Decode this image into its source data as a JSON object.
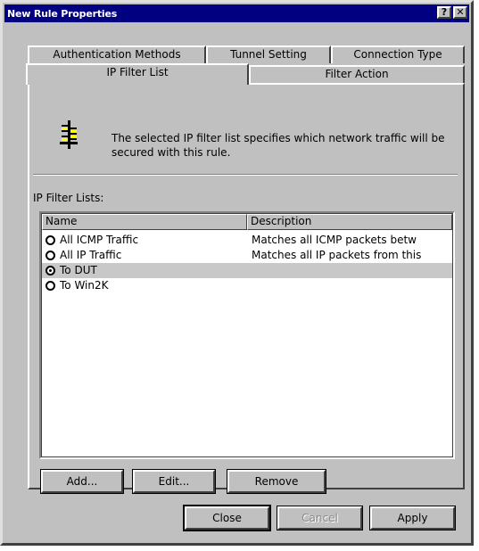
{
  "window": {
    "title": "New Rule Properties",
    "help_glyph": "?",
    "close_glyph": "✕"
  },
  "tabs": {
    "row1": [
      {
        "label": "Authentication Methods"
      },
      {
        "label": "Tunnel Setting"
      },
      {
        "label": "Connection Type"
      }
    ],
    "row2": [
      {
        "label": "IP Filter List",
        "active": true
      },
      {
        "label": "Filter Action"
      }
    ]
  },
  "panel": {
    "description": "The selected IP filter list specifies which network traffic will be secured with this rule.",
    "list_label": "IP Filter Lists:",
    "columns": [
      "Name",
      "Description"
    ],
    "rows": [
      {
        "name": "All ICMP Traffic",
        "description": "Matches all ICMP packets betw",
        "selected": false
      },
      {
        "name": "All IP Traffic",
        "description": "Matches all IP packets from this",
        "selected": false
      },
      {
        "name": "To DUT",
        "description": "",
        "selected": true
      },
      {
        "name": "To Win2K",
        "description": "",
        "selected": false
      }
    ],
    "buttons": {
      "add": "Add...",
      "edit": "Edit...",
      "remove": "Remove"
    }
  },
  "footer": {
    "close": "Close",
    "cancel": "Cancel",
    "apply": "Apply"
  },
  "icons": {
    "filter_list": "ip-filter-list-icon",
    "radio_selected": "radio-on",
    "radio_unselected": "radio-off"
  },
  "colors": {
    "titlebar": "#000080",
    "face": "#c0c0c0",
    "filter_icon_yellow": "#ffff00"
  }
}
